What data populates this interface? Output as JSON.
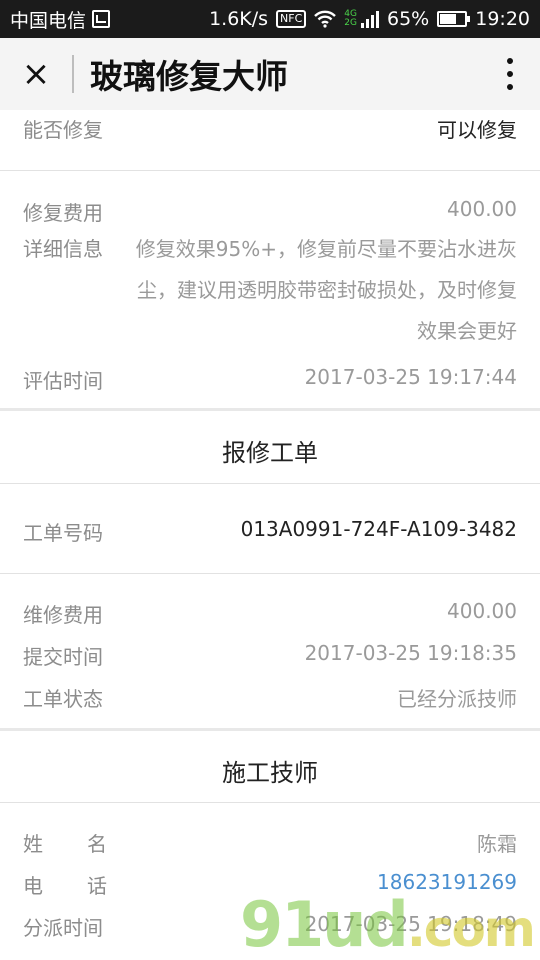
{
  "status_bar": {
    "carrier": "中国电信",
    "speed": "1.6K/s",
    "nfc": "NFC",
    "net_4g": "4G",
    "net_2g": "2G",
    "battery": "65%",
    "time": "19:20",
    "battery_level": 0.65
  },
  "header": {
    "close_label": "×",
    "title": "玻璃修复大师"
  },
  "assessment": {
    "can_repair_label": "能否修复",
    "can_repair_value": "可以修复",
    "fee_label": "修复费用",
    "fee_value": "400.00",
    "detail_label": "详细信息",
    "detail_value": "修复效果95%+，修复前尽量不要沾水进灰尘，建议用透明胶带密封破损处，及时修复效果会更好",
    "time_label": "评估时间",
    "time_value": "2017-03-25 19:17:44"
  },
  "work_order": {
    "section_title": "报修工单",
    "number_label": "工单号码",
    "number_value": "013A0991-724F-A109-3482",
    "fee_label": "维修费用",
    "fee_value": "400.00",
    "submit_label": "提交时间",
    "submit_value": "2017-03-25 19:18:35",
    "status_label": "工单状态",
    "status_value": "已经分派技师"
  },
  "technician": {
    "section_title": "施工技师",
    "name_label": "姓名",
    "name_value": "陈霜",
    "phone_label": "电话",
    "phone_value": "18623191269",
    "assign_label": "分派时间",
    "assign_value": "2017-03-25 19:18:49"
  },
  "watermark": {
    "text": "91ud",
    "suffix": ".com"
  }
}
